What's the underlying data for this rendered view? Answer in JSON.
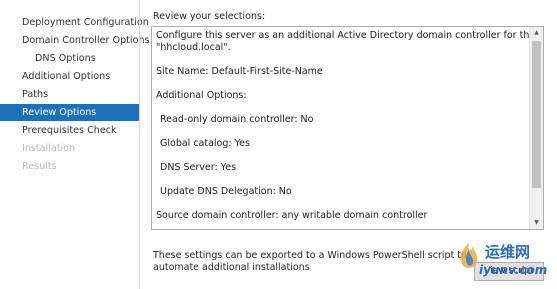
{
  "sidebar": {
    "items": [
      {
        "label": "Deployment Configuration",
        "state": "normal"
      },
      {
        "label": "Domain Controller Options",
        "state": "normal"
      },
      {
        "label": "DNS Options",
        "state": "normal"
      },
      {
        "label": "Additional Options",
        "state": "normal"
      },
      {
        "label": "Paths",
        "state": "normal"
      },
      {
        "label": "Review Options",
        "state": "active"
      },
      {
        "label": "Prerequisites Check",
        "state": "normal"
      },
      {
        "label": "Installation",
        "state": "disabled"
      },
      {
        "label": "Results",
        "state": "disabled"
      }
    ]
  },
  "main": {
    "heading": "Review your selections:",
    "review_lines": [
      "Configure this server as an additional Active Directory domain controller for the domain",
      "\"hhcloud.local\".",
      "Site Name: Default-First-Site-Name",
      "Additional Options:",
      "Read-only domain controller: No",
      "Global catalog: Yes",
      "DNS Server: Yes",
      "Update DNS Delegation: No",
      "Source domain controller: any writable domain controller"
    ],
    "export_text": "These settings can be exported to a Windows PowerShell script to automate additional installations",
    "view_script_button": "View script"
  },
  "watermark": {
    "cn_text": "运维网",
    "url_text": "iyunv.com"
  },
  "colors": {
    "active_nav": "#1e71b8",
    "watermark": "#2f6cae"
  }
}
